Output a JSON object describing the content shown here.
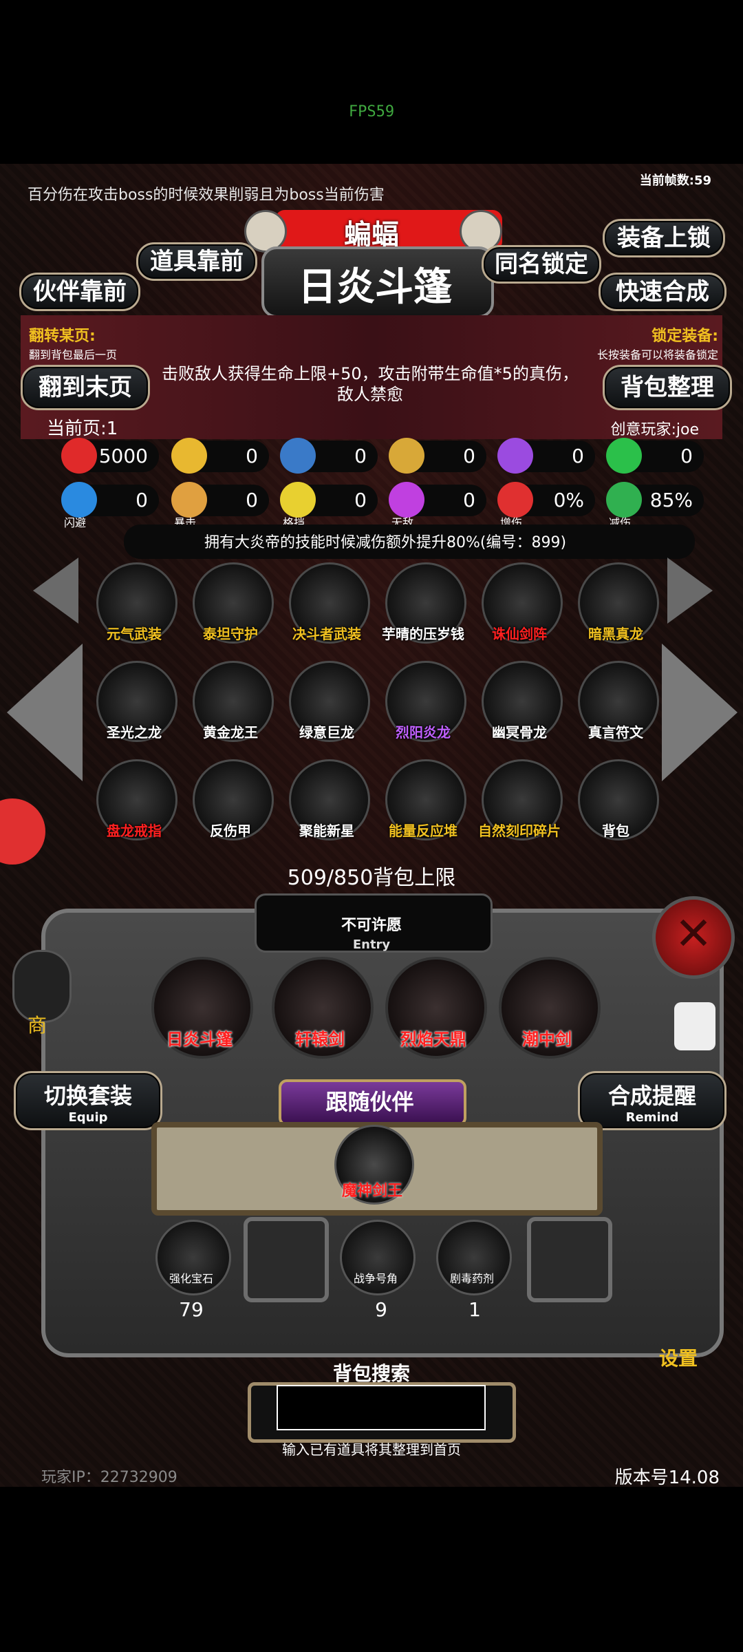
{
  "status": {
    "fps": "FPS59",
    "frame_count": "当前帧数:59"
  },
  "notice": "百分伤在攻击boss的时候效果削弱且为boss当前伤害",
  "header": {
    "monster_name": "蝙蝠",
    "item_title": "日炎斗篷"
  },
  "buttons": {
    "items_front": "道具靠前",
    "partner_front": "伙伴靠前",
    "same_name_lock": "同名锁定",
    "equip_lock": "装备上锁",
    "quick_merge": "快速合成",
    "flip_last": "翻到末页",
    "bag_sort": "背包整理",
    "switch_set": "切换套装",
    "switch_set_en": "Equip",
    "merge_remind": "合成提醒",
    "merge_remind_en": "Remind",
    "follow_partner": "跟随伙伴",
    "shop": "商",
    "settings": "设置"
  },
  "hints": {
    "flip_page_title": "翻转某页:",
    "flip_page_desc": "翻到背包最后一页",
    "lock_equip_title": "锁定装备:",
    "lock_equip_desc": "长按装备可以将装备锁定"
  },
  "description": "击败敌人获得生命上限+50，攻击附带生命值*5的真伤，敌人禁愈",
  "page": {
    "current": "当前页:1",
    "player": "创意玩家:joe"
  },
  "stats_row1": [
    {
      "icon": "heart-icon",
      "value": "5000",
      "color": "#e02a2a"
    },
    {
      "icon": "strength-icon",
      "value": "0",
      "color": "#e8b830"
    },
    {
      "icon": "helmet-icon",
      "value": "0",
      "color": "#3a7ac8"
    },
    {
      "icon": "sword-icon",
      "value": "0",
      "color": "#d8a838"
    },
    {
      "icon": "lightning-icon",
      "value": "0",
      "color": "#9b4be0"
    },
    {
      "icon": "clover-icon",
      "value": "0",
      "color": "#2bc04a"
    }
  ],
  "stats_row2": [
    {
      "icon": "dodge-icon",
      "value": "0",
      "label": "闪避",
      "color": "#2a8ae0"
    },
    {
      "icon": "crit-icon",
      "value": "0",
      "label": "暴击",
      "color": "#e0a040"
    },
    {
      "icon": "block-icon",
      "value": "0",
      "label": "格挡",
      "color": "#e8d030"
    },
    {
      "icon": "invincible-icon",
      "value": "0",
      "label": "无敌",
      "color": "#c040e0"
    },
    {
      "icon": "damage-boost-icon",
      "value": "0%",
      "label": "增伤",
      "color": "#e03030"
    },
    {
      "icon": "damage-reduce-icon",
      "value": "85%",
      "label": "减伤",
      "color": "#30b050"
    }
  ],
  "skill_note": "拥有大炎帝的技能时候减伤额外提升80%(编号：899)",
  "inventory": [
    {
      "label": "元气武装",
      "color": "#f0c020",
      "icon": "armor-icon"
    },
    {
      "label": "泰坦守护",
      "color": "#f0c020",
      "icon": "titan-icon"
    },
    {
      "label": "决斗者武装",
      "color": "#f0c020",
      "icon": "duelist-icon"
    },
    {
      "label": "芋晴的压岁钱",
      "color": "#ffffff",
      "icon": "red-envelope-icon"
    },
    {
      "label": "诛仙剑阵",
      "color": "#ff2020",
      "icon": "sword-array-icon"
    },
    {
      "label": "暗黑真龙",
      "color": "#f0c020",
      "icon": "dragon-icon"
    },
    {
      "label": "圣光之龙",
      "color": "#ffffff",
      "icon": "dragon-icon"
    },
    {
      "label": "黄金龙王",
      "color": "#ffffff",
      "icon": "dragon-icon"
    },
    {
      "label": "绿意巨龙",
      "color": "#ffffff",
      "icon": "dragon-icon"
    },
    {
      "label": "烈阳炎龙",
      "color": "#c060ff",
      "icon": "dragon-icon"
    },
    {
      "label": "幽冥骨龙",
      "color": "#ffffff",
      "icon": "dragon-icon"
    },
    {
      "label": "真言符文",
      "color": "#ffffff",
      "icon": "rune-icon"
    },
    {
      "label": "盘龙戒指",
      "color": "#ff2020",
      "icon": "ring-icon"
    },
    {
      "label": "反伤甲",
      "color": "#ffffff",
      "icon": "armor-icon"
    },
    {
      "label": "聚能新星",
      "color": "#ffffff",
      "icon": "nova-icon"
    },
    {
      "label": "能量反应堆",
      "color": "#f0c020",
      "icon": "reactor-icon"
    },
    {
      "label": "自然刻印碎片",
      "color": "#f0c020",
      "icon": "seal-icon"
    },
    {
      "label": "背包",
      "color": "#ffffff",
      "icon": "bag-icon"
    }
  ],
  "bag_limit": "509/850背包上限",
  "entry": {
    "title": "不可许愿",
    "subtitle": "Entry"
  },
  "equipped": [
    {
      "label": "日炎斗篷",
      "icon": "cloak-icon"
    },
    {
      "label": "轩辕剑",
      "icon": "sword-icon"
    },
    {
      "label": "烈焰天鼎",
      "icon": "cauldron-icon"
    },
    {
      "label": "潮中剑",
      "icon": "sword-icon"
    }
  ],
  "partner": {
    "label": "魔神剑王"
  },
  "items": [
    {
      "label": "强化宝石",
      "count": "79"
    },
    {
      "label": "战争号角",
      "count": "9"
    },
    {
      "label": "剧毒药剂",
      "count": "1"
    }
  ],
  "search": {
    "title": "背包搜索",
    "placeholder": "",
    "hint": "输入已有道具将其整理到首页"
  },
  "footer": {
    "player_ip": "玩家IP：22732909",
    "version": "版本号14.08"
  },
  "colors": {
    "accent_red": "#e01818",
    "gold": "#f0c020",
    "frame": "#8d7a62"
  }
}
